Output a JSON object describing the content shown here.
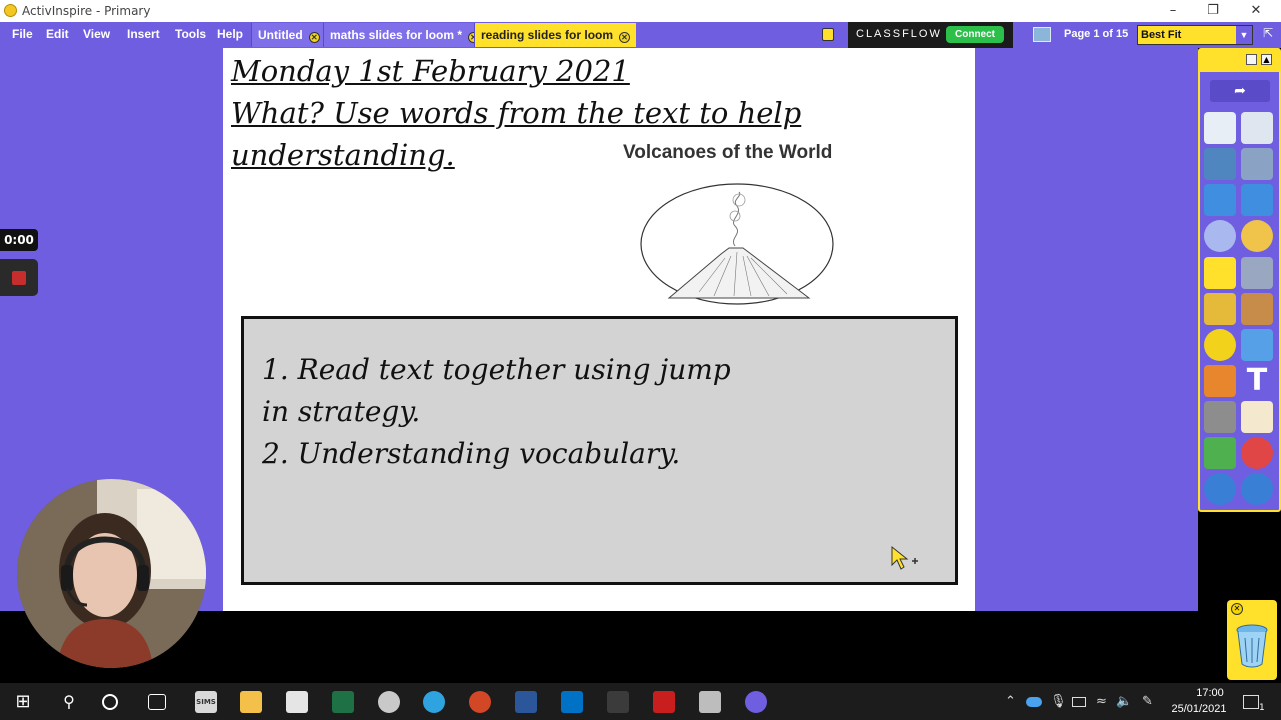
{
  "window": {
    "title": "ActivInspire - Primary"
  },
  "menu": [
    "File",
    "Edit",
    "View",
    "Insert",
    "Tools",
    "Help"
  ],
  "tabs": [
    {
      "label": "Untitled",
      "active": false
    },
    {
      "label": "maths slides for loom *",
      "active": false
    },
    {
      "label": "reading slides for loom",
      "active": true
    }
  ],
  "classflow": {
    "label": "CLASSFLOW",
    "connect": "Connect"
  },
  "page_indicator": "Page 1 of 15",
  "zoom": {
    "selected": "Best Fit"
  },
  "slide": {
    "date": "Monday 1st February 2021",
    "question_line1": "What? Use words from the text to help",
    "question_line2": "understanding.",
    "image_title": "Volcanoes of the World",
    "task_lines": [
      "1.  Read text together using jump",
      "in strategy.",
      "2.  Understanding vocabulary."
    ]
  },
  "recorder": {
    "timer": "0:00"
  },
  "taskbar": {
    "time": "17:00",
    "date": "25/01/2021",
    "sims_label": "SIMS",
    "notification_count": "1"
  },
  "colors": {
    "accent": "#6f5fe0",
    "highlight": "#ffe02a"
  }
}
